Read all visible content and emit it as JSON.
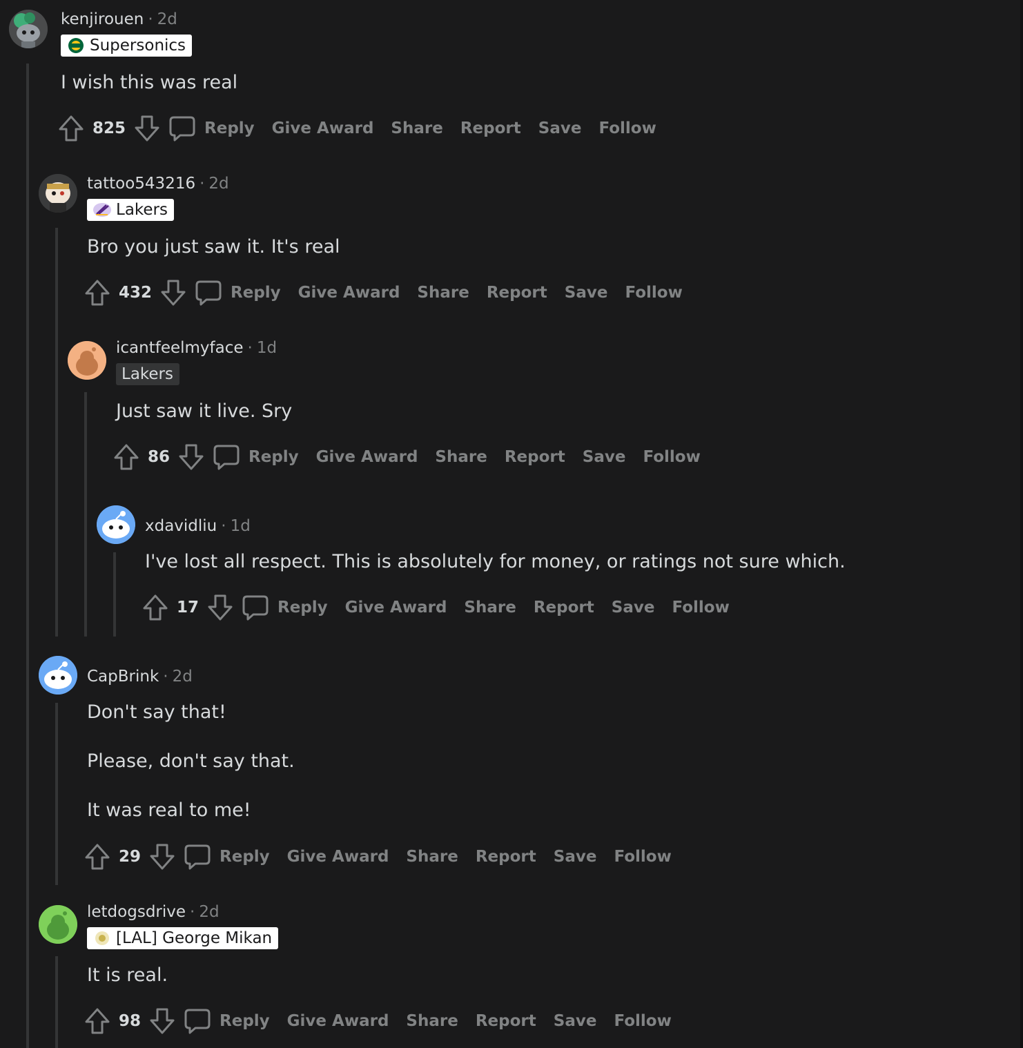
{
  "colors": {
    "background": "#1a1a1b",
    "text": "#d7dadc",
    "muted": "#818384",
    "thread_line": "#343536"
  },
  "action_labels": {
    "reply": "Reply",
    "give_award": "Give Award",
    "share": "Share",
    "report": "Report",
    "save": "Save",
    "follow": "Follow"
  },
  "comments": [
    {
      "username": "kenjirouen",
      "separator": "·",
      "age": "2d",
      "flair": "Supersonics",
      "flair_icon": "supersonics-logo-icon",
      "body": [
        "I wish this was real"
      ],
      "score": "825"
    },
    {
      "username": "tattoo543216",
      "separator": "·",
      "age": "2d",
      "flair": "Lakers",
      "flair_icon": "lakers-logo-icon",
      "body": [
        "Bro you just saw it. It's real"
      ],
      "score": "432"
    },
    {
      "username": "icantfeelmyface",
      "separator": "·",
      "age": "1d",
      "flair": "Lakers",
      "body": [
        "Just saw it live. Sry"
      ],
      "score": "86"
    },
    {
      "username": "xdavidliu",
      "separator": "·",
      "age": "1d",
      "body": [
        "I've lost all respect. This is absolutely for money, or ratings not sure which."
      ],
      "score": "17"
    },
    {
      "username": "CapBrink",
      "separator": "·",
      "age": "2d",
      "body": [
        "Don't say that!",
        "Please, don't say that.",
        "It was real to me!"
      ],
      "score": "29"
    },
    {
      "username": "letdogsdrive",
      "separator": "·",
      "age": "2d",
      "flair": "[LAL] George Mikan",
      "flair_icon": "george-mikan-icon",
      "body": [
        "It is real."
      ],
      "score": "98"
    }
  ]
}
